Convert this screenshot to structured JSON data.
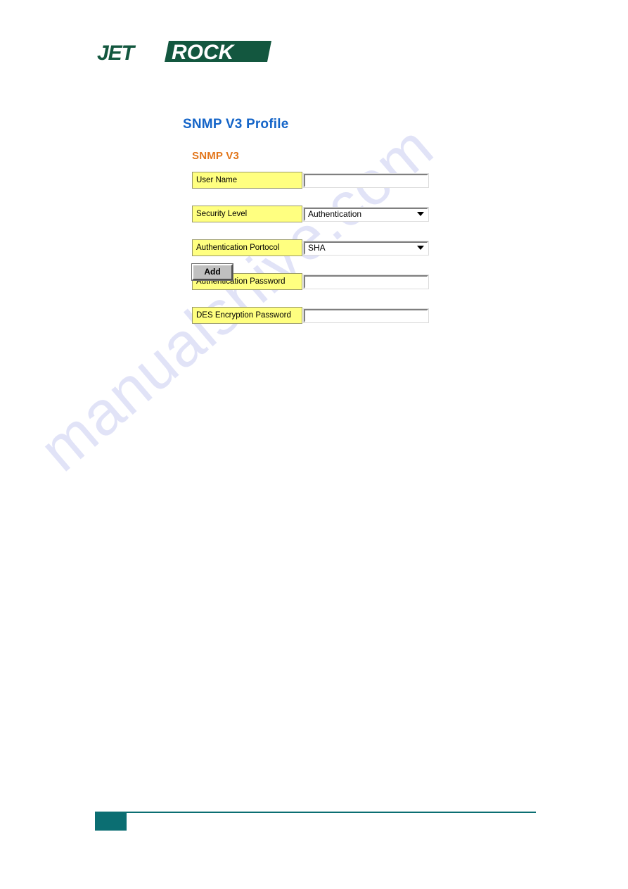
{
  "page": {
    "title": "SNMP V3 Profile",
    "section_title": "SNMP V3",
    "watermark": "manualshive.com"
  },
  "brand": {
    "logo_text_left": "JET",
    "logo_text_right": "ROCK",
    "logo_color": "#13573f",
    "logo_alt": "JETROCK"
  },
  "colors": {
    "title_blue": "#1565c8",
    "section_orange": "#e2761b",
    "label_yellow": "#ffff80",
    "footer_teal": "#0b6e72",
    "button_gray": "#c0c0c0",
    "watermark_lavender": "#c9cdf2"
  },
  "form": {
    "rows": [
      {
        "label": "User Name",
        "type": "text",
        "value": "",
        "placeholder": ""
      },
      {
        "label": "Security Level",
        "type": "select",
        "value": "Authentication",
        "options": [
          "Authentication"
        ]
      },
      {
        "label": "Authentication Portocol",
        "type": "select",
        "value": "SHA",
        "options": [
          "SHA"
        ]
      },
      {
        "label": "Authentication Password",
        "type": "text",
        "value": "",
        "placeholder": ""
      },
      {
        "label": "DES Encryption Password",
        "type": "text",
        "value": "",
        "placeholder": ""
      }
    ],
    "submit_label": "Add"
  }
}
